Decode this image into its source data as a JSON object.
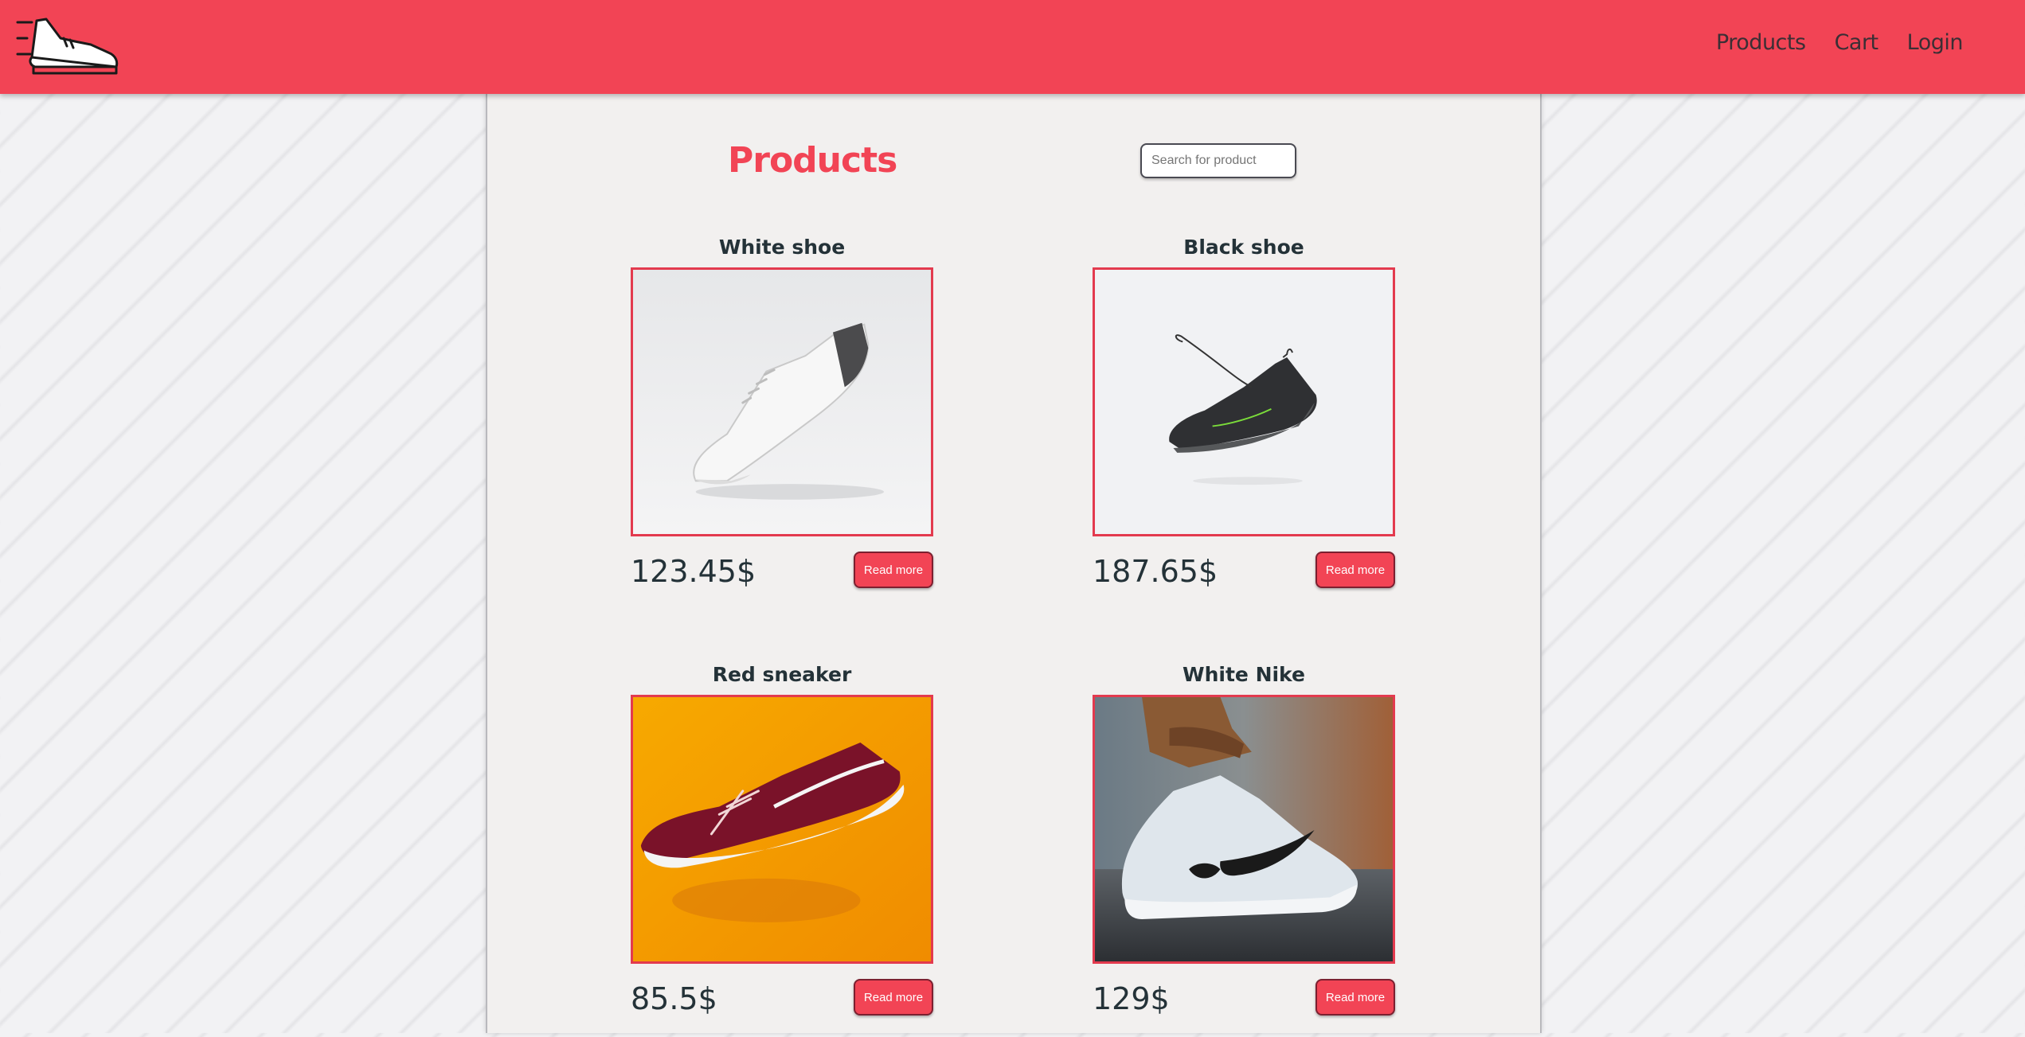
{
  "header": {
    "logo_icon": "sneaker-logo-icon",
    "nav": {
      "products": "Products",
      "cart": "Cart",
      "login": "Login"
    }
  },
  "main": {
    "title": "Products",
    "search": {
      "placeholder": "Search for product",
      "value": ""
    },
    "products": [
      {
        "name": "White shoe",
        "price": "123.45$",
        "button": "Read more",
        "image": "white-shoe-photo"
      },
      {
        "name": "Black shoe",
        "price": "187.65$",
        "button": "Read more",
        "image": "black-shoe-photo"
      },
      {
        "name": "Red sneaker",
        "price": "85.5$",
        "button": "Read more",
        "image": "red-sneaker-photo"
      },
      {
        "name": "White Nike",
        "price": "129$",
        "button": "Read more",
        "image": "white-nike-photo"
      }
    ]
  },
  "colors": {
    "brand": "#f24455",
    "text": "#243238",
    "panel": "#f2f0ef",
    "image_border": "#e33a4e"
  }
}
